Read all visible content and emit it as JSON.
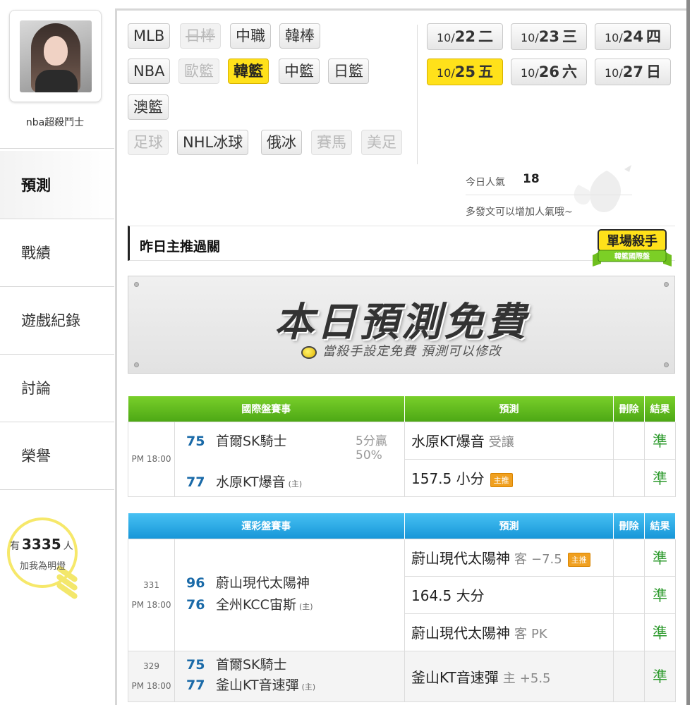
{
  "user": {
    "name": "nba超殺鬥士"
  },
  "sidebar": {
    "items": [
      {
        "label": "預測"
      },
      {
        "label": "戰績"
      },
      {
        "label": "遊戲紀錄"
      },
      {
        "label": "討論"
      },
      {
        "label": "榮譽"
      }
    ],
    "fans": {
      "prefix": "有",
      "count": "3335",
      "suffix": "人",
      "sub": "加我為明燈"
    }
  },
  "sports": {
    "row1": [
      "MLB",
      "日棒",
      "中職",
      "韓棒"
    ],
    "row2": [
      "NBA",
      "歐籃",
      "韓籃",
      "中籃",
      "日籃"
    ],
    "row3": [
      "澳籃"
    ],
    "row4": [
      "足球",
      "NHL冰球",
      "俄冰",
      "賽馬",
      "美足"
    ]
  },
  "dates": [
    {
      "md_small": "10/",
      "md_big": "22",
      "wd": "二"
    },
    {
      "md_small": "10/",
      "md_big": "23",
      "wd": "三"
    },
    {
      "md_small": "10/",
      "md_big": "24",
      "wd": "四"
    },
    {
      "md_small": "10/",
      "md_big": "25",
      "wd": "五"
    },
    {
      "md_small": "10/",
      "md_big": "26",
      "wd": "六"
    },
    {
      "md_small": "10/",
      "md_big": "27",
      "wd": "日"
    }
  ],
  "popularity": {
    "label": "今日人氣",
    "value": "18",
    "hint": "多發文可以增加人氣哦~"
  },
  "yesterday": {
    "title": "昨日主推過關"
  },
  "badge": {
    "title": "單場殺手",
    "sub": "韓籃國際盤"
  },
  "free_banner": {
    "title": "本日預測免費",
    "subtitle": "當殺手設定免費 預測可以修改"
  },
  "intl_table": {
    "headers": {
      "event": "國際盤賽事",
      "predict": "預測",
      "delete": "刪除",
      "result": "結果"
    },
    "game": {
      "time": "PM 18:00",
      "away": {
        "score": "75",
        "team": "首爾SK騎士"
      },
      "home": {
        "score": "77",
        "team": "水原KT爆音",
        "tag": "(主)"
      },
      "ratio_line1": "5分贏",
      "ratio_line2": "50%",
      "predictions": [
        {
          "text": "水原KT爆音",
          "side": "受讓",
          "result": "準"
        },
        {
          "text": "157.5 小分",
          "tag": "主推",
          "result": "準"
        }
      ]
    }
  },
  "lottery_table": {
    "headers": {
      "event": "運彩盤賽事",
      "predict": "預測",
      "delete": "刪除",
      "result": "結果"
    },
    "games": [
      {
        "code": "331",
        "time": "PM 18:00",
        "away": {
          "score": "96",
          "team": "蔚山現代太陽神"
        },
        "home": {
          "score": "76",
          "team": "全州KCC宙斯",
          "tag": "(主)"
        },
        "predictions": [
          {
            "text": "蔚山現代太陽神",
            "side": "客",
            "line": "−7.5",
            "tag": "主推",
            "result": "準"
          },
          {
            "text": "164.5 大分",
            "result": "準"
          },
          {
            "text": "蔚山現代太陽神",
            "side": "客",
            "line": "PK",
            "result": "準"
          }
        ]
      },
      {
        "code": "329",
        "time": "PM 18:00",
        "away": {
          "score": "75",
          "team": "首爾SK騎士"
        },
        "home": {
          "score": "77",
          "team": "釜山KT音速彈",
          "tag": "(主)"
        },
        "predictions": [
          {
            "text": "釜山KT音速彈",
            "side": "主",
            "line": "+5.5",
            "result": "準"
          }
        ]
      }
    ]
  },
  "colors": {
    "accent_yellow": "#ffe11a",
    "green_header": "#4da815",
    "blue_header": "#1796d8",
    "result_green": "#2d9a2d",
    "score_blue": "#1a6aa8"
  }
}
